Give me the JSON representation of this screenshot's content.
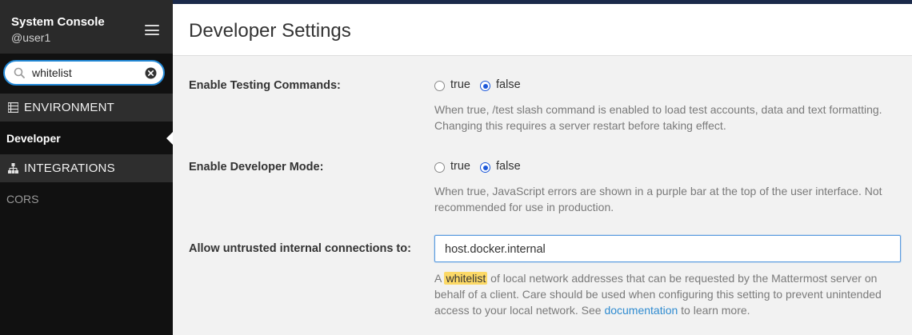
{
  "sidebar": {
    "title": "System Console",
    "user": "@user1",
    "menu_icon": "hamburger-icon",
    "search": {
      "value": "whitelist",
      "placeholder": "",
      "icon": "search-icon",
      "clear_icon": "clear-icon"
    },
    "sections": [
      {
        "label": "ENVIRONMENT",
        "icon": "list-icon",
        "items": [
          {
            "label": "Developer",
            "active": true
          }
        ]
      },
      {
        "label": "INTEGRATIONS",
        "icon": "sitemap-icon",
        "items": [
          {
            "label": "CORS",
            "active": false
          }
        ]
      }
    ]
  },
  "page": {
    "title": "Developer Settings",
    "settings": [
      {
        "label": "Enable Testing Commands:",
        "options": [
          "true",
          "false"
        ],
        "selected": "false",
        "help": "When true, /test slash command is enabled to load test accounts, data and text formatting. Changing this requires a server restart before taking effect."
      },
      {
        "label": "Enable Developer Mode:",
        "options": [
          "true",
          "false"
        ],
        "selected": "false",
        "help": "When true, JavaScript errors are shown in a purple bar at the top of the user interface. Not recommended for use in production."
      },
      {
        "label": "Allow untrusted internal connections to:",
        "value": "host.docker.internal",
        "help": {
          "prefix": "A ",
          "highlight": "whitelist",
          "middle": " of local network addresses that can be requested by the Mattermost server on behalf of a client. Care should be used when configuring this setting to prevent unintended access to your local network. See ",
          "link": "documentation",
          "suffix": " to learn more."
        }
      }
    ]
  },
  "colors": {
    "sidebar_bg": "#111111",
    "sidebar_header_bg": "#2a2a2a",
    "section_bg": "#2e2e2e",
    "accent": "#2389d7",
    "radio": "#1c58d9",
    "highlight": "#fcd967",
    "link": "#2f8bd0",
    "top_bar": "#1b2a4a"
  }
}
